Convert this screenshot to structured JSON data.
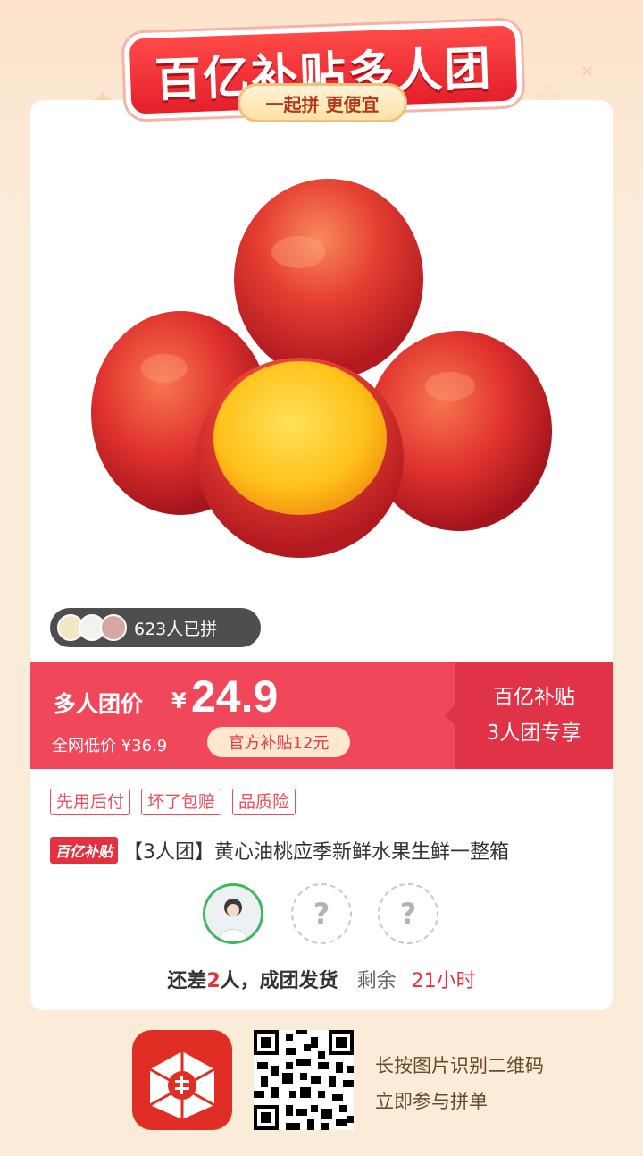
{
  "header": {
    "title": "百亿补贴多人团",
    "subtitle": "一起拼 更便宜"
  },
  "product": {
    "image_icon": "nectarine-fruit-image",
    "buyers_count_text": "623人已拼"
  },
  "price_bar": {
    "label": "多人团价",
    "currency": "¥",
    "price": "24.9",
    "original_price_text": "全网低价 ¥36.9",
    "subsidy_chip": "官方补贴12元",
    "right_line1": "百亿补贴",
    "right_line2": "3人团专享"
  },
  "tags": [
    "先用后付",
    "坏了包赔",
    "品质险"
  ],
  "title_row": {
    "badge": "百亿补贴",
    "title": "【3人团】黄心油桃应季新鲜水果生鲜一整箱"
  },
  "group": {
    "empty_slot_mark": "?",
    "status_prefix": "还差",
    "status_number": "2",
    "status_suffix": "人，成团发货",
    "remaining_label": "剩余",
    "remaining_time": "21小时"
  },
  "footer": {
    "line1": "长按图片识别二维码",
    "line2": "立即参与拼单",
    "logo_icon": "pinduoduo-logo-icon",
    "qr_icon": "qr-code-icon"
  },
  "colors": {
    "accent_red": "#f1475a",
    "dark_red": "#e13347",
    "banner_red": "#e41f2b",
    "background": "#fbecd9"
  }
}
